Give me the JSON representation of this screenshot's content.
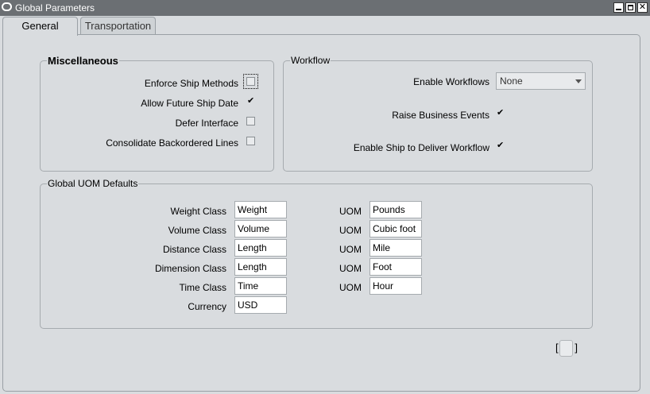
{
  "window": {
    "title": "Global Parameters",
    "close_glyph": "✕"
  },
  "tabs": [
    {
      "label": "General",
      "active": true
    },
    {
      "label": "Transportation",
      "active": false
    }
  ],
  "miscellaneous": {
    "title": "Miscellaneous",
    "items": [
      {
        "label": "Enforce Ship Methods",
        "checked": false,
        "focused": true
      },
      {
        "label": "Allow Future Ship Date",
        "checked": true
      },
      {
        "label": "Defer Interface",
        "checked": false
      },
      {
        "label": "Consolidate Backordered Lines",
        "checked": false
      }
    ]
  },
  "workflow": {
    "title": "Workflow",
    "enable_workflows": {
      "label": "Enable Workflows",
      "value": "None"
    },
    "raise_business_events": {
      "label": "Raise Business Events",
      "checked": true
    },
    "enable_ship_to_deliver": {
      "label": "Enable Ship to Deliver Workflow",
      "checked": true
    }
  },
  "uom_defaults": {
    "title": "Global UOM Defaults",
    "rows": [
      {
        "label": "Weight Class",
        "value": "Weight",
        "uom_label": "UOM",
        "uom": "Pounds"
      },
      {
        "label": "Volume Class",
        "value": "Volume",
        "uom_label": "UOM",
        "uom": "Cubic foot"
      },
      {
        "label": "Distance Class",
        "value": "Length",
        "uom_label": "UOM",
        "uom": "Mile"
      },
      {
        "label": "Dimension Class",
        "value": "Length",
        "uom_label": "UOM",
        "uom": "Foot"
      },
      {
        "label": "Time Class",
        "value": "Time",
        "uom_label": "UOM",
        "uom": "Hour"
      },
      {
        "label": "Currency",
        "value": "USD"
      }
    ]
  },
  "check_glyph": "✔",
  "footer": {
    "bracket_left": "[",
    "bracket_right": "]"
  }
}
